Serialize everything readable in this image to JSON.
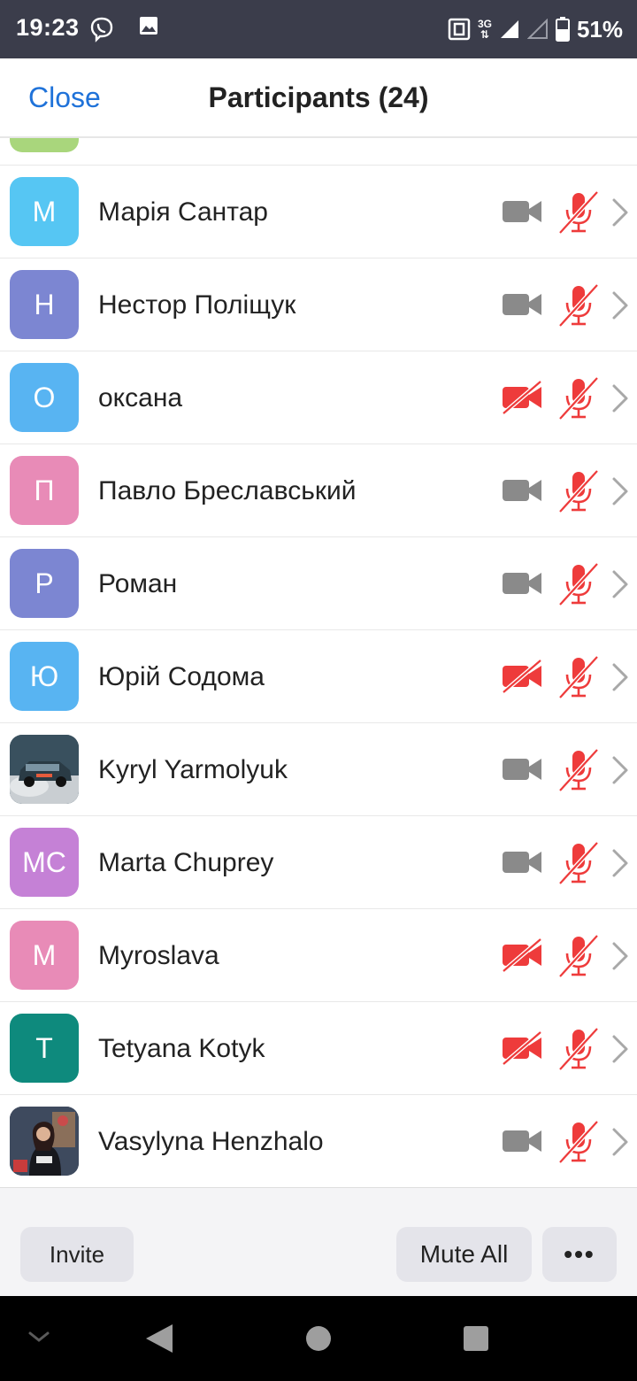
{
  "status_bar": {
    "time": "19:23",
    "network": "3G",
    "battery": "51%",
    "icons": [
      "viber-icon",
      "image-icon",
      "nfc-icon",
      "signal-icon",
      "signal-empty-icon",
      "battery-icon"
    ]
  },
  "header": {
    "close_label": "Close",
    "title": "Participants (24)"
  },
  "colors": {
    "accent": "#1f72d9",
    "muted_red": "#ee3b3b",
    "video_on_gray": "#8a8a8a",
    "chevron_gray": "#a8a8a8"
  },
  "participants": [
    {
      "initials": "M",
      "name": "Марія Сантар",
      "avatar_color": "#56c6f3",
      "video": "on",
      "audio": "muted"
    },
    {
      "initials": "Н",
      "name": "Нестор Поліщук",
      "avatar_color": "#7c86d2",
      "video": "on",
      "audio": "muted"
    },
    {
      "initials": "О",
      "name": "оксана",
      "avatar_color": "#58b4f2",
      "video": "off",
      "audio": "muted"
    },
    {
      "initials": "П",
      "name": "Павло Бреславський",
      "avatar_color": "#e88bb7",
      "video": "on",
      "audio": "muted"
    },
    {
      "initials": "Р",
      "name": "Роман",
      "avatar_color": "#7c86d2",
      "video": "on",
      "audio": "muted"
    },
    {
      "initials": "Ю",
      "name": "Юрій Содома",
      "avatar_color": "#58b4f2",
      "video": "off",
      "audio": "muted"
    },
    {
      "initials": "",
      "name": "Kyryl Yarmolyuk",
      "avatar_color": "#4a6070",
      "avatar_photo": "car-photo",
      "video": "on",
      "audio": "muted"
    },
    {
      "initials": "MC",
      "name": "Marta Chuprey",
      "avatar_color": "#c581d6",
      "video": "on",
      "audio": "muted"
    },
    {
      "initials": "M",
      "name": "Myroslava",
      "avatar_color": "#e88bb7",
      "video": "off",
      "audio": "muted"
    },
    {
      "initials": "T",
      "name": "Tetyana Kotyk",
      "avatar_color": "#0e8a7d",
      "video": "off",
      "audio": "muted"
    },
    {
      "initials": "",
      "name": "Vasylyna Henzhalo",
      "avatar_color": "#2a3548",
      "avatar_photo": "woman-photo",
      "video": "on",
      "audio": "muted"
    }
  ],
  "footer": {
    "invite_label": "Invite",
    "mute_all_label": "Mute All",
    "more_label": "•••"
  },
  "nav": {
    "icons": [
      "collapse-chevron-icon",
      "back-icon",
      "home-icon",
      "recents-icon"
    ]
  }
}
